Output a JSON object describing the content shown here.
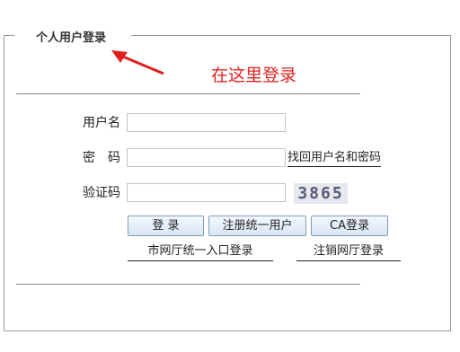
{
  "panel": {
    "legend": "个人用户登录"
  },
  "annotation": {
    "text": "在这里登录",
    "color": "#e02020"
  },
  "form": {
    "username_label": "用户名",
    "password_label": "密　码",
    "captcha_label": "验证码",
    "username_value": "",
    "password_value": "",
    "captcha_value": "",
    "recover_link": "找回用户名和密码",
    "captcha_text": "3865"
  },
  "buttons": {
    "login": "登 录",
    "register": "注册统一用户",
    "ca_login": "CA登录"
  },
  "links": {
    "unified_entry": "市网厅统一入口登录",
    "logout": "注销网厅登录"
  }
}
